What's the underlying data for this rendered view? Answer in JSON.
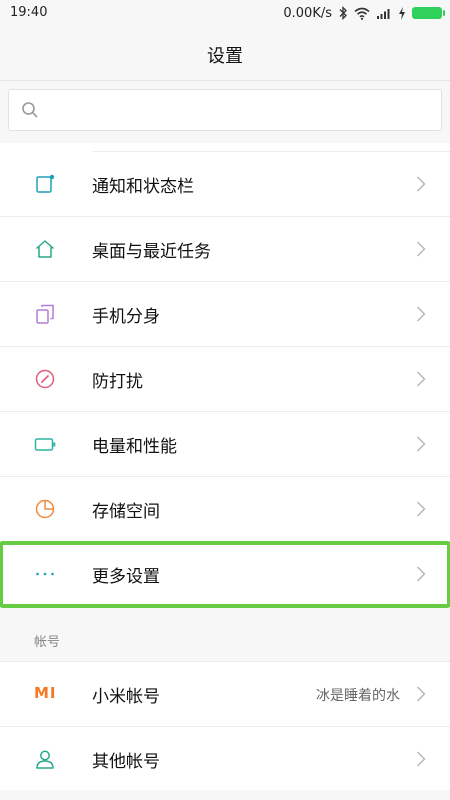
{
  "status_bar": {
    "time": "19:40",
    "net_speed": "0.00K/s",
    "icons": [
      "bluetooth-icon",
      "wifi-icon",
      "signal-icon",
      "charging-icon",
      "battery-icon"
    ],
    "battery_color": "#2fd15b"
  },
  "header": {
    "title": "设置"
  },
  "search": {
    "placeholder": "",
    "value": ""
  },
  "settings_items": [
    {
      "label": "通知和状态栏",
      "icon": "notification-icon",
      "icon_color": "#21a0b8"
    },
    {
      "label": "桌面与最近任务",
      "icon": "home-icon",
      "icon_color": "#2aa88a"
    },
    {
      "label": "手机分身",
      "icon": "dual-phone-icon",
      "icon_color": "#b37fd6"
    },
    {
      "label": "防打扰",
      "icon": "do-not-disturb-icon",
      "icon_color": "#e35d78"
    },
    {
      "label": "电量和性能",
      "icon": "battery-performance-icon",
      "icon_color": "#2bb5a0"
    },
    {
      "label": "存储空间",
      "icon": "storage-icon",
      "icon_color": "#f28a3c"
    },
    {
      "label": "更多设置",
      "icon": "more-icon",
      "icon_color": "#21a0b8",
      "highlighted": true
    }
  ],
  "account_section": {
    "title": "帐号",
    "items": [
      {
        "label": "小米帐号",
        "icon": "mi-logo-icon",
        "icon_text": "MI",
        "value": "冰是睡着的水",
        "icon_color": "#f47a22"
      },
      {
        "label": "其他帐号",
        "icon": "person-icon",
        "value": "",
        "icon_color": "#2aa88a"
      }
    ]
  },
  "colors": {
    "highlight": "#66cc44",
    "background": "#f7f7f7",
    "divider": "#ececec"
  }
}
